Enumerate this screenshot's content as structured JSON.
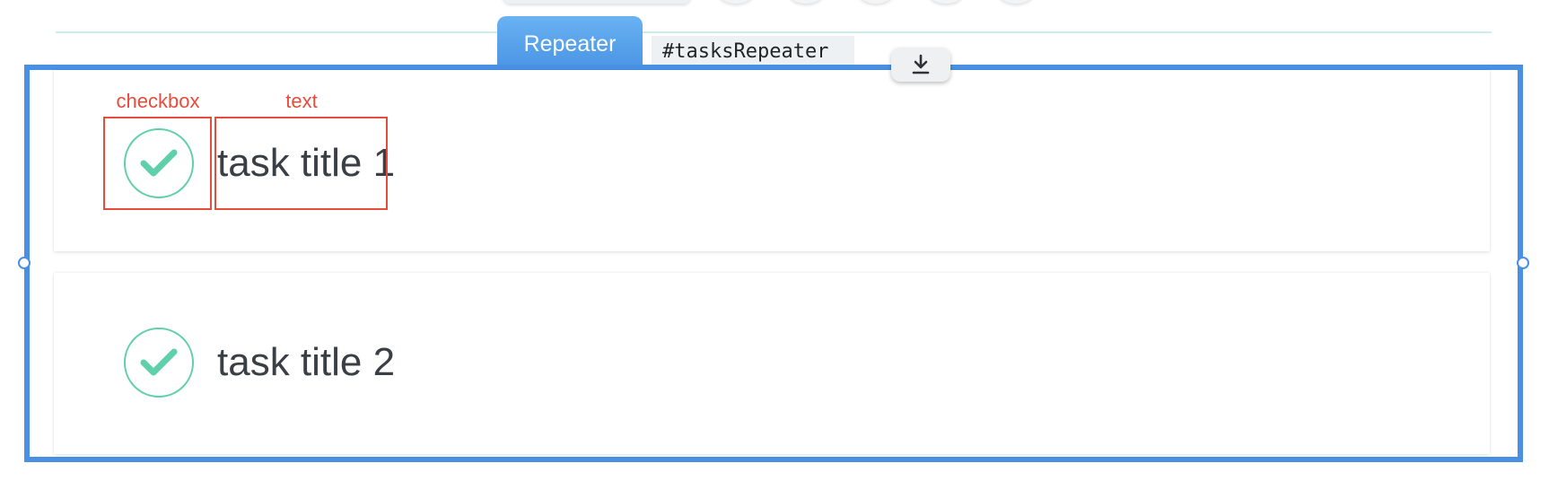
{
  "repeater": {
    "tab_label": "Repeater",
    "element_id": "#tasksRepeater"
  },
  "annotations": {
    "checkbox_label": "checkbox",
    "text_label": "text"
  },
  "items": [
    {
      "title": "task title 1",
      "checked": true
    },
    {
      "title": "task title 2",
      "checked": true
    }
  ],
  "colors": {
    "selection_frame": "#4a90e2",
    "check_accent": "#5fd0aa",
    "annotation": "#e74c3c"
  },
  "icons": {
    "download": "download-icon",
    "check": "check-icon"
  }
}
